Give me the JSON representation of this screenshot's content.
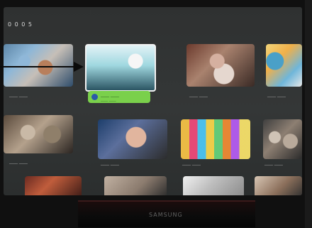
{
  "screen": {
    "section_title": "0 0 0 5",
    "row1": {
      "captions": [
        "____ ____",
        "____ ____",
        "____ ____",
        "____ ____"
      ],
      "focused_bar": {
        "title": "____ ____",
        "subtitle": "____ ____"
      }
    },
    "row2": {
      "captions": [
        "____ ____",
        "____ ____",
        "____ ____",
        "____ ____"
      ]
    }
  },
  "device": {
    "brand_text": "SAMSUNG"
  }
}
